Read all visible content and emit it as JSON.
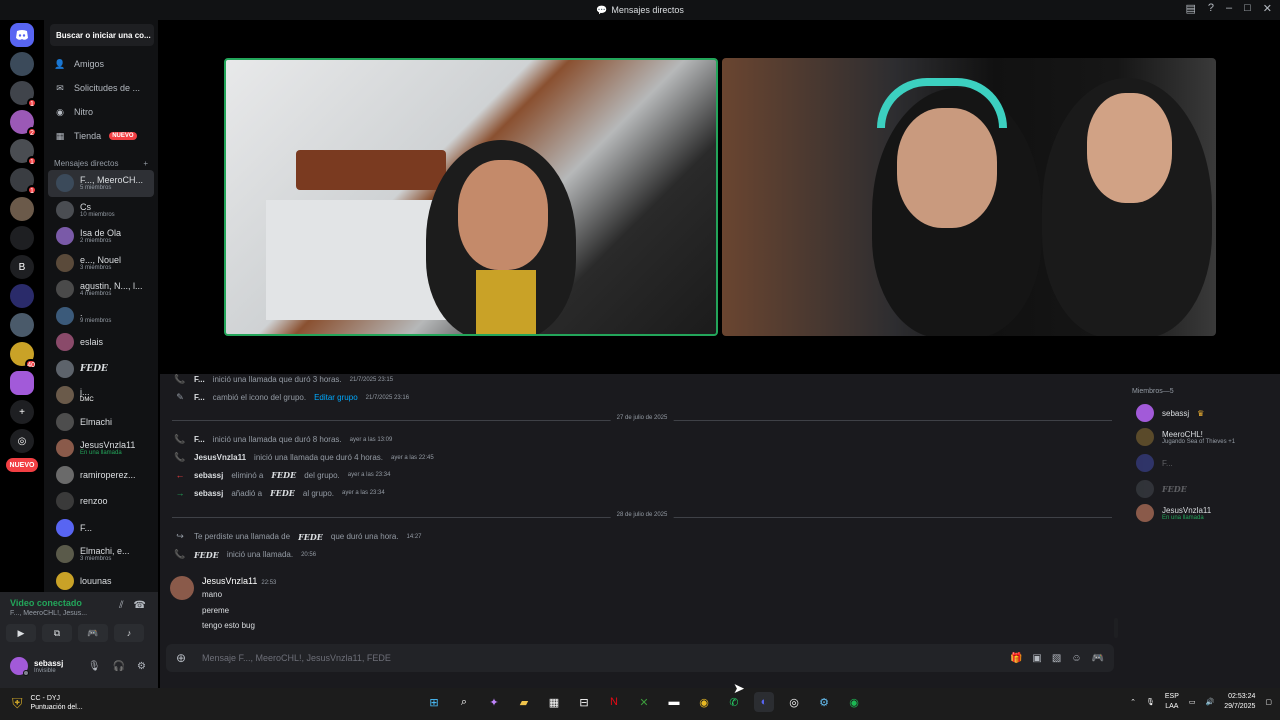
{
  "window": {
    "title": "Mensajes directos"
  },
  "servers": [
    {
      "label": "",
      "badge": ""
    },
    {
      "label": "",
      "badge": "1"
    },
    {
      "label": "",
      "badge": "2"
    },
    {
      "label": "",
      "badge": "1"
    },
    {
      "label": "",
      "badge": "1"
    },
    {
      "label": "",
      "badge": ""
    },
    {
      "label": "",
      "badge": ""
    },
    {
      "label": "B",
      "badge": ""
    },
    {
      "label": "",
      "badge": ""
    },
    {
      "label": "",
      "badge": ""
    },
    {
      "label": "",
      "badge": "40"
    },
    {
      "label": "",
      "badge": ""
    }
  ],
  "server_new_label": "NUEVO",
  "sidebar": {
    "search_placeholder": "Buscar o iniciar una co...",
    "nav": [
      {
        "label": "Amigos",
        "icon": "friends-icon"
      },
      {
        "label": "Solicitudes de ...",
        "icon": "envelope-icon"
      },
      {
        "label": "Nitro",
        "icon": "nitro-icon"
      },
      {
        "label": "Tienda",
        "icon": "shop-icon",
        "tag": "NUEVO"
      }
    ],
    "dm_header": "Mensajes directos",
    "dms": [
      {
        "name": "F..., MeeroCH...",
        "sub": "5 miembros",
        "selected": true
      },
      {
        "name": "Cs",
        "sub": "10 miembros"
      },
      {
        "name": "Isa de Ola",
        "sub": "2 miembros"
      },
      {
        "name": "e..., Nouel",
        "sub": "3 miembros"
      },
      {
        "name": "agustin, N..., l...",
        "sub": "4 miembros"
      },
      {
        "name": ".",
        "sub": "9 miembros"
      },
      {
        "name": "eslais",
        "sub": ""
      },
      {
        "name": "FEDE",
        "sub": ""
      },
      {
        "name": "j...",
        "sub": "",
        "tag": "DMC"
      },
      {
        "name": "Elmachi",
        "sub": ""
      },
      {
        "name": "JesusVnzla11",
        "sub": "En una llamada",
        "call": true
      },
      {
        "name": "ramiroperez...",
        "sub": ""
      },
      {
        "name": "renzoo",
        "sub": ""
      },
      {
        "name": "F...",
        "sub": ""
      },
      {
        "name": "Elmachi, e...",
        "sub": "3 miembros"
      },
      {
        "name": "louunas",
        "sub": ""
      }
    ]
  },
  "voice": {
    "status": "Video conectado",
    "channel": "F..., MeeroCHL!, Jesus...",
    "user_name": "sebassj",
    "user_status": "Invisible"
  },
  "chat": {
    "events": [
      {
        "icon": "phone-icon",
        "color": "g",
        "who": "F...",
        "text": "inició una llamada que duró 3 horas.",
        "ts": "21/7/2025 23:15"
      },
      {
        "icon": "pencil-icon",
        "color": "n",
        "who": "F...",
        "text": "cambió el icono del grupo.",
        "link": "Editar grupo",
        "ts": "21/7/2025 23:16"
      },
      {
        "icon": "phone-icon",
        "color": "g",
        "who": "F...",
        "text": "inició una llamada que duró 8 horas.",
        "ts": "ayer a las 13:09"
      },
      {
        "icon": "phone-icon",
        "color": "g",
        "who": "JesusVnzla11",
        "text": "inició una llamada que duró 4 horas.",
        "ts": "ayer a las 22:45"
      },
      {
        "icon": "arrow-left-icon",
        "color": "r",
        "who": "sebassj",
        "text": "eliminó a",
        "target": "FEDE",
        "text2": "del grupo.",
        "ts": "ayer a las 23:34"
      },
      {
        "icon": "arrow-right-icon",
        "color": "g",
        "who": "sebassj",
        "text": "añadió a",
        "target": "FEDE",
        "text2": "al grupo.",
        "ts": "ayer a las 23:34"
      },
      {
        "icon": "missed-call-icon",
        "color": "n",
        "who": "",
        "text": "Te perdiste una llamada de",
        "target": "FEDE",
        "text2": "que duró una hora.",
        "ts": "14:27"
      },
      {
        "icon": "phone-icon",
        "color": "g",
        "who": "",
        "target_first": "FEDE",
        "text": "inició una llamada.",
        "ts": "20:56"
      }
    ],
    "dividers": [
      "27 de julio de 2025",
      "28 de julio de 2025"
    ],
    "post": {
      "author": "JesusVnzla11",
      "time": "22:53",
      "lines": [
        "mano",
        "pereme",
        "tengo esto bug"
      ]
    },
    "composer_placeholder": "Mensaje F..., MeeroCHL!, JesusVnzla11, FEDE"
  },
  "members": {
    "header": "Miembros—5",
    "list": [
      {
        "name": "sebassj",
        "sub": "",
        "crown": true,
        "dim": false
      },
      {
        "name": "MeeroCHL!",
        "sub": "Jugando Sea of Thieves +1",
        "dim": false
      },
      {
        "name": "F...",
        "sub": "",
        "dim": true
      },
      {
        "name": "FEDE",
        "sub": "",
        "dim": true
      },
      {
        "name": "JesusVnzla11",
        "sub": "En una llamada",
        "dim": false
      }
    ]
  },
  "taskbar": {
    "weather_title": "CC - DYJ",
    "weather_sub": "Puntuación del...",
    "lang1": "ESP",
    "lang2": "LAA",
    "time": "02:53:24",
    "date": "29/7/2025"
  },
  "colors": {
    "accent": "#5865f2",
    "online": "#23a55a",
    "danger": "#f23f43",
    "link": "#00a8fc"
  }
}
